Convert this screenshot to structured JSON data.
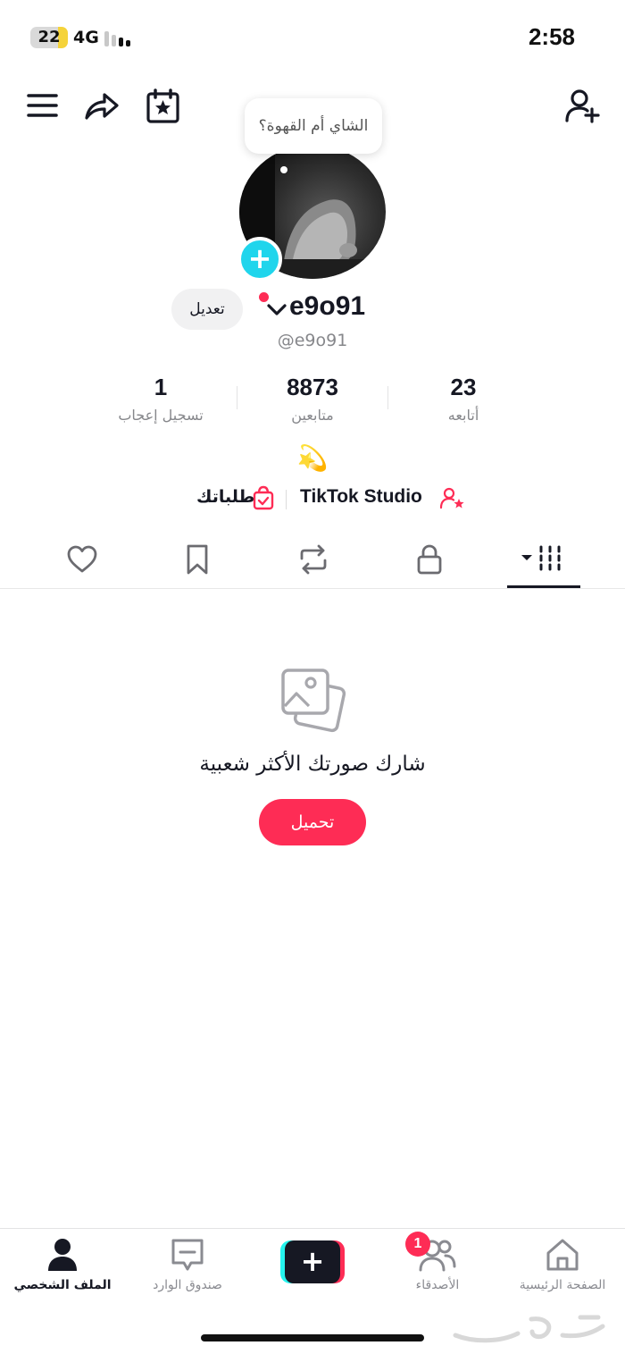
{
  "status_bar": {
    "battery": "22",
    "network": "4G",
    "time": "2:58"
  },
  "profile": {
    "bubble_text": "الشاي أم القهوة؟",
    "edit_label": "تعديل",
    "display_name": "e9o91",
    "handle": "@e9o91",
    "bio": "💫"
  },
  "stats": [
    {
      "value": "1",
      "label": "تسجيل إعجاب"
    },
    {
      "value": "8873",
      "label": "متابعين"
    },
    {
      "value": "23",
      "label": "أتابعه"
    }
  ],
  "links": {
    "orders_label": "طلباتك",
    "studio_label": "TikTok Studio"
  },
  "tabs": [
    {
      "name": "liked",
      "icon": "heart-icon"
    },
    {
      "name": "favorites",
      "icon": "bookmark-icon"
    },
    {
      "name": "reposts",
      "icon": "repost-icon"
    },
    {
      "name": "private",
      "icon": "lock-icon"
    },
    {
      "name": "videos",
      "icon": "grid-icon",
      "active": true
    }
  ],
  "empty_state": {
    "message": "شارك صورتك الأكثر شعبية",
    "button_label": "تحميل"
  },
  "bottom_nav": {
    "profile_label": "الملف الشخصي",
    "inbox_label": "صندوق الوارد",
    "friends_label": "الأصدقاء",
    "friends_badge": "1",
    "home_label": "الصفحة الرئيسية",
    "create_label": "+"
  },
  "colors": {
    "accent": "#fe2c55",
    "cyan": "#25f4ee",
    "text": "#161823",
    "muted": "#86878b"
  }
}
